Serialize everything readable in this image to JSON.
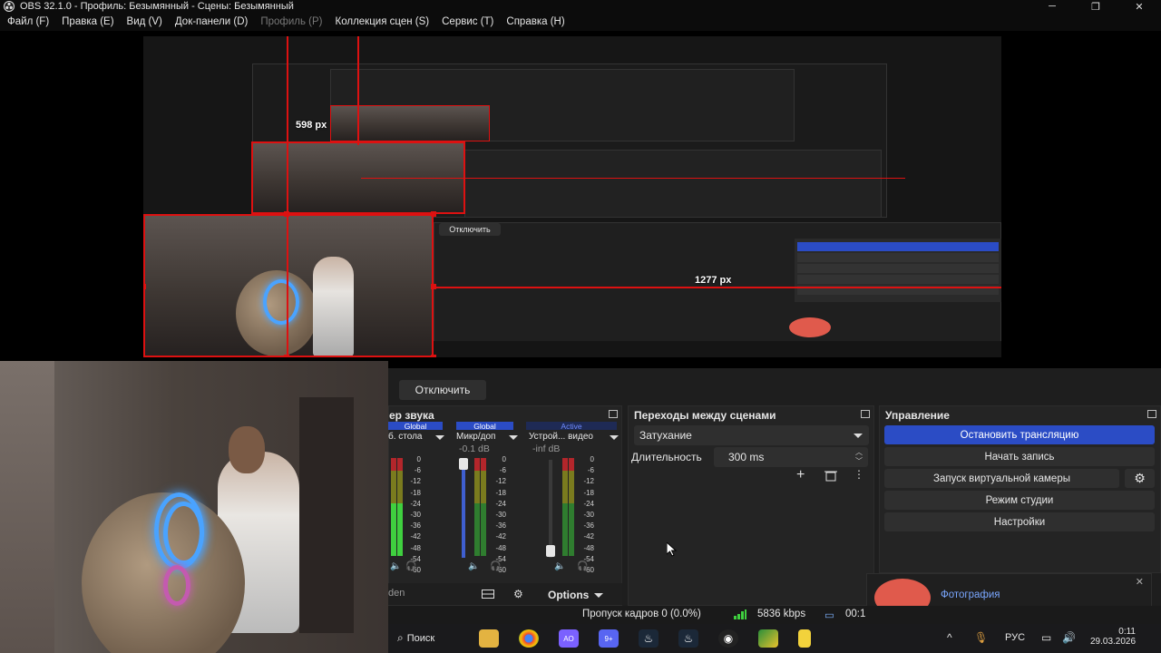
{
  "window": {
    "title": "OBS 32.1.0 - Профиль: Безымянный - Сцены: Безымянный",
    "controls": [
      "─",
      "❐",
      "✕"
    ]
  },
  "menu": [
    {
      "label": "Файл (F)",
      "enabled": true
    },
    {
      "label": "Правка (E)",
      "enabled": true
    },
    {
      "label": "Вид (V)",
      "enabled": true
    },
    {
      "label": "Док-панели (D)",
      "enabled": true
    },
    {
      "label": "Профиль (P)",
      "enabled": false
    },
    {
      "label": "Коллекция сцен (S)",
      "enabled": true
    },
    {
      "label": "Сервис (T)",
      "enabled": true
    },
    {
      "label": "Справка (H)",
      "enabled": true
    }
  ],
  "preview": {
    "width_label": "1277 px",
    "height_label": "598 px",
    "nested_disconnect": "Отключить",
    "nested_status": "Пропуск кадров 0 (0.0%)",
    "nested_kbps": "5836 kbps"
  },
  "disconnect_button": "Отключить",
  "mixer": {
    "title": "ер звука",
    "tags": [
      "Global",
      "Global",
      "Active"
    ],
    "channels": [
      {
        "name": "б. стола",
        "db": ""
      },
      {
        "name": "Микр/доп",
        "db": "-0.1 dB"
      },
      {
        "name": "Устрой... видео",
        "db": "-inf dB"
      }
    ],
    "scale": [
      "0",
      "-6",
      "-12",
      "-18",
      "-24",
      "-30",
      "-36",
      "-42",
      "-48",
      "-54",
      "-60"
    ],
    "footer_hidden": "den",
    "options_label": "Options"
  },
  "transitions": {
    "title": "Переходы между сценами",
    "selected": "Затухание",
    "duration_label": "Длительность",
    "duration_value": "300 ms"
  },
  "controls": {
    "title": "Управление",
    "buttons": [
      "Остановить трансляцию",
      "Начать запись",
      "Запуск виртуальной камеры",
      "Режим студии",
      "Настройки"
    ]
  },
  "status": {
    "dropped": "Пропуск кадров 0 (0.0%)",
    "kbps": "5836 kbps",
    "time": "00:1"
  },
  "notification": {
    "label": "Фотография",
    "close": "✕"
  },
  "taskbar": {
    "search": "Поиск",
    "badge_ao": "AO",
    "badge_discord": "9+",
    "lang": "РУС",
    "time": "0:11",
    "date": "29.03.2026"
  },
  "colors": {
    "accent": "#2b4cc5",
    "recording_red": "#e05a4c",
    "guide_red": "#dd1111",
    "active_tag": "#3f5fd0"
  }
}
